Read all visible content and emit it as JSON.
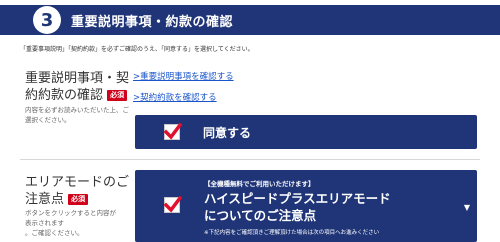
{
  "header": {
    "step_number": "3",
    "title": "重要説明事項・約款の確認"
  },
  "intro": {
    "text": "「重要事項説明」「契約約款」を必ずご確認のうえ、「同意する」を選択してください。"
  },
  "important_section": {
    "label_line1": "重要説明事項・契",
    "label_line2": "約約款の確認",
    "required_badge": "必須",
    "note_line1": "内容を必ずお読みいただいた上、ご",
    "note_line2": "選択ください。",
    "link_important": ">重要説明事項を確認する",
    "link_terms": ">契約約款を確認する",
    "agree_label": "同意する",
    "agree_checked": true
  },
  "area_mode_section": {
    "label_line1": "エリアモードのご",
    "label_line2": "注意点",
    "required_badge": "必須",
    "note_line1": "ボタンをクリックすると内容が",
    "note_line2": "表示されます",
    "note_line3": "。ご確認ください。",
    "notice_sub": "【全機種無料でご利用いただけます】",
    "notice_title_line1": "ハイスピードプラスエリアモード",
    "notice_title_line2": "についてのご注意点",
    "notice_foot": "※下記内容をご確認頂きご理解頂けた場合は次の項目へお進みください",
    "notice_checked": true
  },
  "colors": {
    "navy": "#1f3578",
    "required_red": "#d0021b",
    "check_red": "#e0102e",
    "link_blue": "#1a55c9"
  }
}
